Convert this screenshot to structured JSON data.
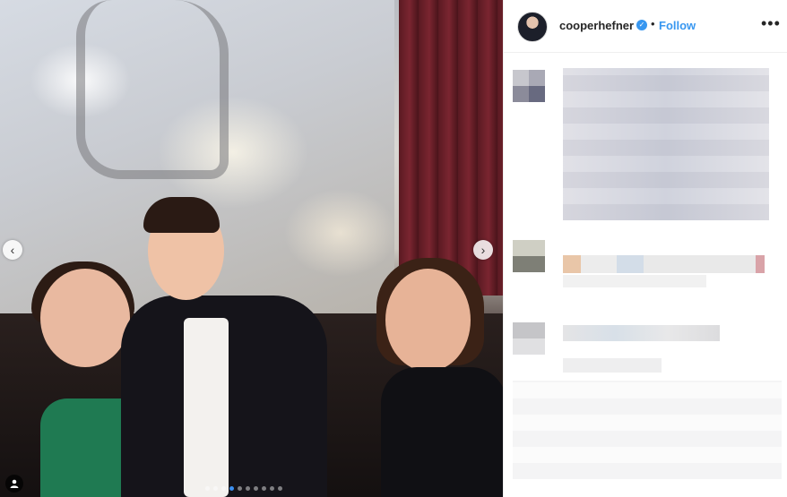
{
  "post": {
    "author": {
      "username": "cooperhefner",
      "verified_icon": "verified-badge-icon",
      "separator": "•",
      "follow_label": "Follow"
    },
    "more_label": "•••"
  },
  "carousel": {
    "prev_icon": "chevron-left-icon",
    "next_icon": "chevron-right-icon",
    "prev_glyph": "‹",
    "next_glyph": "›",
    "tag_icon": "user-tag-icon",
    "slide_count": 10,
    "active_slide": 4
  },
  "colors": {
    "follow": "#3897f0",
    "username": "#262626",
    "active_dot": "#3b8ff0"
  }
}
